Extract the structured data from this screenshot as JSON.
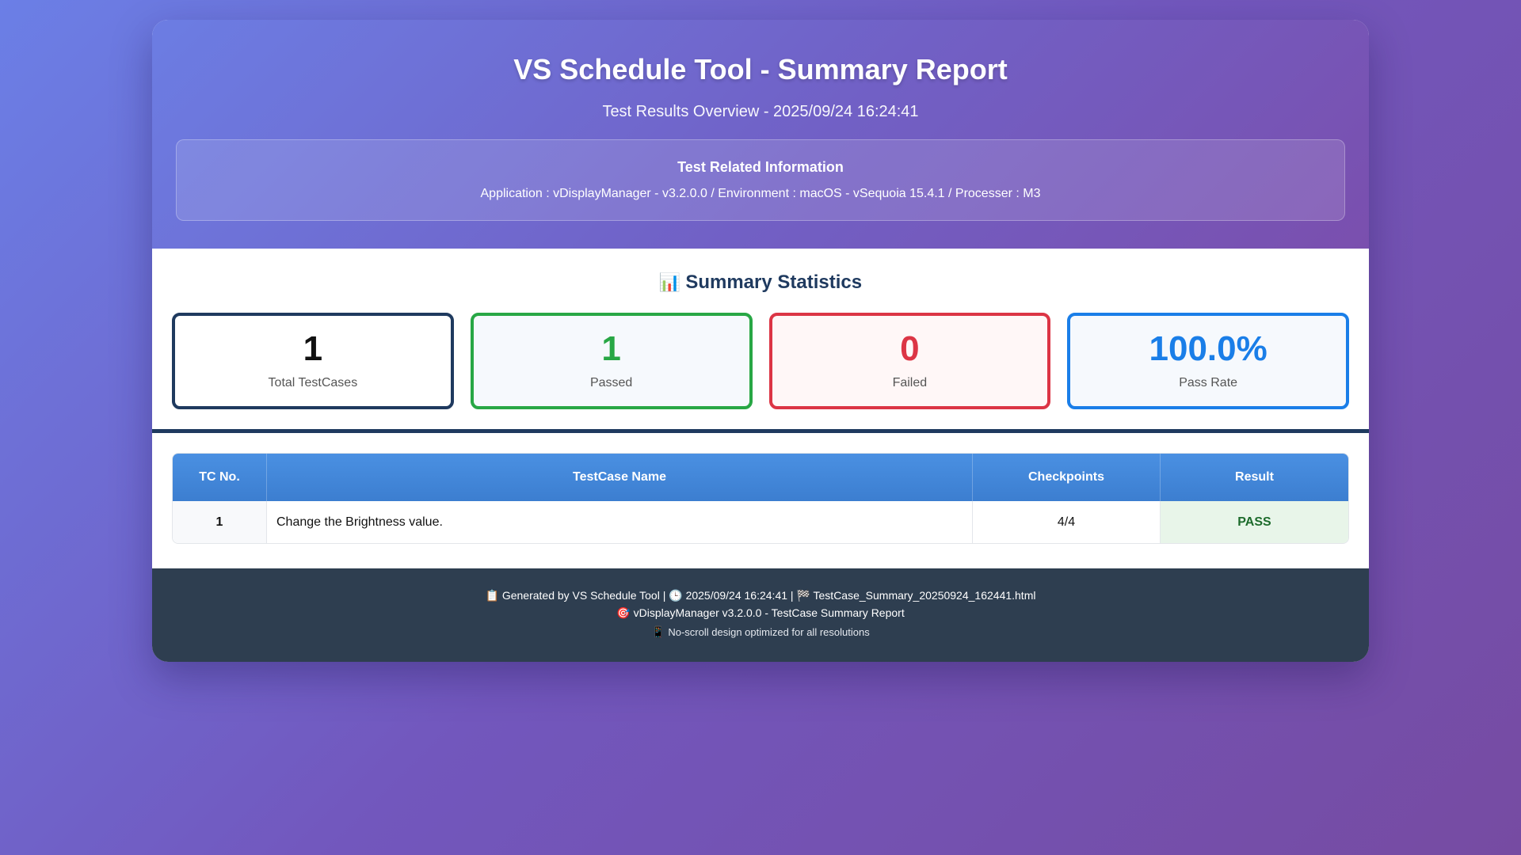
{
  "header": {
    "title": "VS Schedule Tool - Summary Report",
    "subtitle": "Test Results Overview - 2025/09/24 16:24:41",
    "info_title": "Test Related Information",
    "info_text": "Application : vDisplayManager - v3.2.0.0 / Environment : macOS - vSequoia 15.4.1 / Processer : M3"
  },
  "stats": {
    "icon": "bar-chart-icon",
    "icon_glyph": "📊",
    "title": "Summary Statistics",
    "cards": [
      {
        "value": "1",
        "label": "Total TestCases",
        "color": "#1f3a5f"
      },
      {
        "value": "1",
        "label": "Passed",
        "color": "#28a745"
      },
      {
        "value": "0",
        "label": "Failed",
        "color": "#dc3545"
      },
      {
        "value": "100.0%",
        "label": "Pass Rate",
        "color": "#1a7ee8"
      }
    ]
  },
  "table": {
    "columns": [
      "TC No.",
      "TestCase Name",
      "Checkpoints",
      "Result"
    ],
    "rows": [
      {
        "tc_no": "1",
        "name": "Change the Brightness value.",
        "checkpoints": "4/4",
        "result": "PASS"
      }
    ]
  },
  "footer": {
    "icon1": "📋",
    "generated": "Generated by VS Schedule Tool |",
    "icon2": "🕒",
    "time": "2025/09/24 16:24:41 |",
    "icon3": "🏁",
    "file": "TestCase_Summary_20250924_162441.html",
    "icon4": "🎯",
    "line2": "vDisplayManager v3.2.0.0 - TestCase Summary Report",
    "icon5": "📱",
    "line3": "No-scroll design optimized for all resolutions"
  }
}
